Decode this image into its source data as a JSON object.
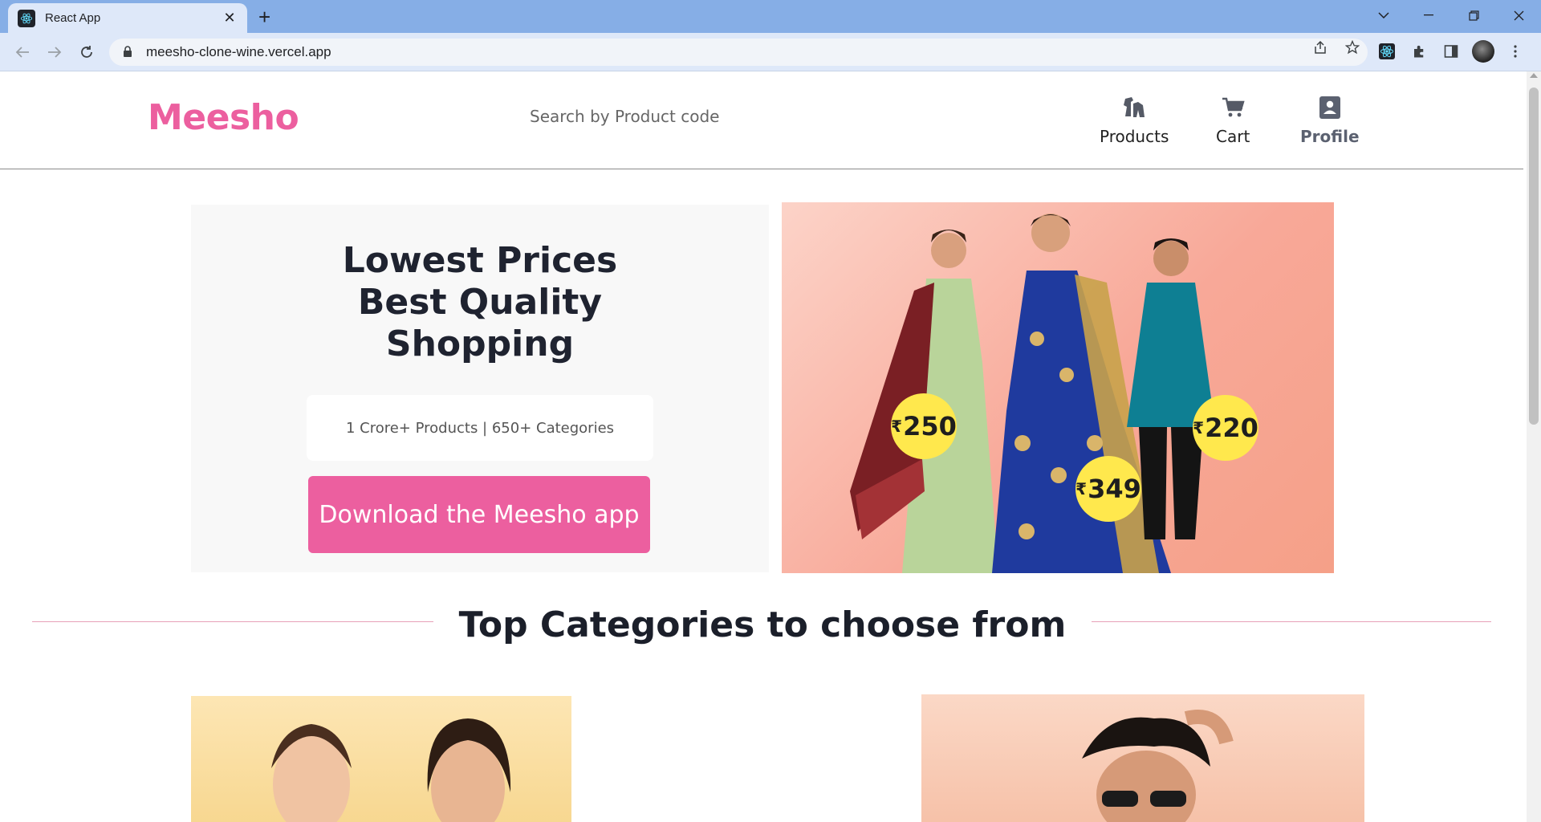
{
  "browser": {
    "tab_title": "React App",
    "url": "meesho-clone-wine.vercel.app",
    "new_tab_label": "+",
    "tab_close_label": "✕"
  },
  "header": {
    "logo": "Meesho",
    "search_placeholder": "Search by Product code",
    "nav": [
      {
        "label": "Products",
        "icon": "shirt-icon"
      },
      {
        "label": "Cart",
        "icon": "cart-icon"
      },
      {
        "label": "Profile",
        "icon": "profile-icon"
      }
    ]
  },
  "hero": {
    "title_lines": [
      "Lowest Prices",
      "Best Quality",
      "Shopping"
    ],
    "subtitle": "1 Crore+ Products | 650+ Categories",
    "cta": "Download the Meesho app",
    "prices": [
      "250",
      "349",
      "220"
    ],
    "currency": "₹"
  },
  "categories": {
    "title": "Top Categories to choose from"
  },
  "colors": {
    "brand": "#ec5f9f",
    "tabbar": "#86aee6",
    "badge": "#ffe84d"
  }
}
